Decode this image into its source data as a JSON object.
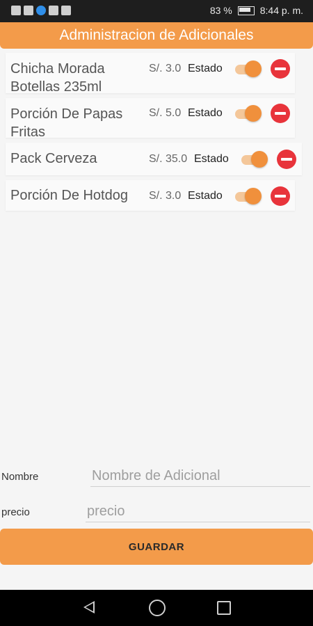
{
  "status_bar": {
    "battery_percent": "83 %",
    "time": "8:44 p. m.",
    "icons": [
      "signal-icon",
      "wifi-icon",
      "notification-icon",
      "app-icon",
      "photo-icon",
      "battery-icon"
    ]
  },
  "header": {
    "title": "Administracion de Adicionales"
  },
  "items": [
    {
      "name": "Chicha Morada Botellas 235ml",
      "price": "S/. 3.0",
      "state_label": "Estado",
      "enabled": true
    },
    {
      "name": "Porción De Papas Fritas",
      "price": "S/. 5.0",
      "state_label": "Estado",
      "enabled": true
    },
    {
      "name": "Pack Cerveza",
      "price": "S/. 35.0",
      "state_label": "Estado",
      "enabled": true
    },
    {
      "name": "Porción De Hotdog",
      "price": "S/. 3.0",
      "state_label": "Estado",
      "enabled": true
    }
  ],
  "form": {
    "name_label": "Nombre",
    "name_placeholder": "Nombre de Adicional",
    "name_value": "",
    "price_label": "precio",
    "price_placeholder": "precio",
    "price_value": ""
  },
  "save_button": {
    "label": "GUARDAR"
  },
  "colors": {
    "accent": "#f39b4a",
    "toggle_on": "#f0903c",
    "delete": "#e8343b"
  }
}
